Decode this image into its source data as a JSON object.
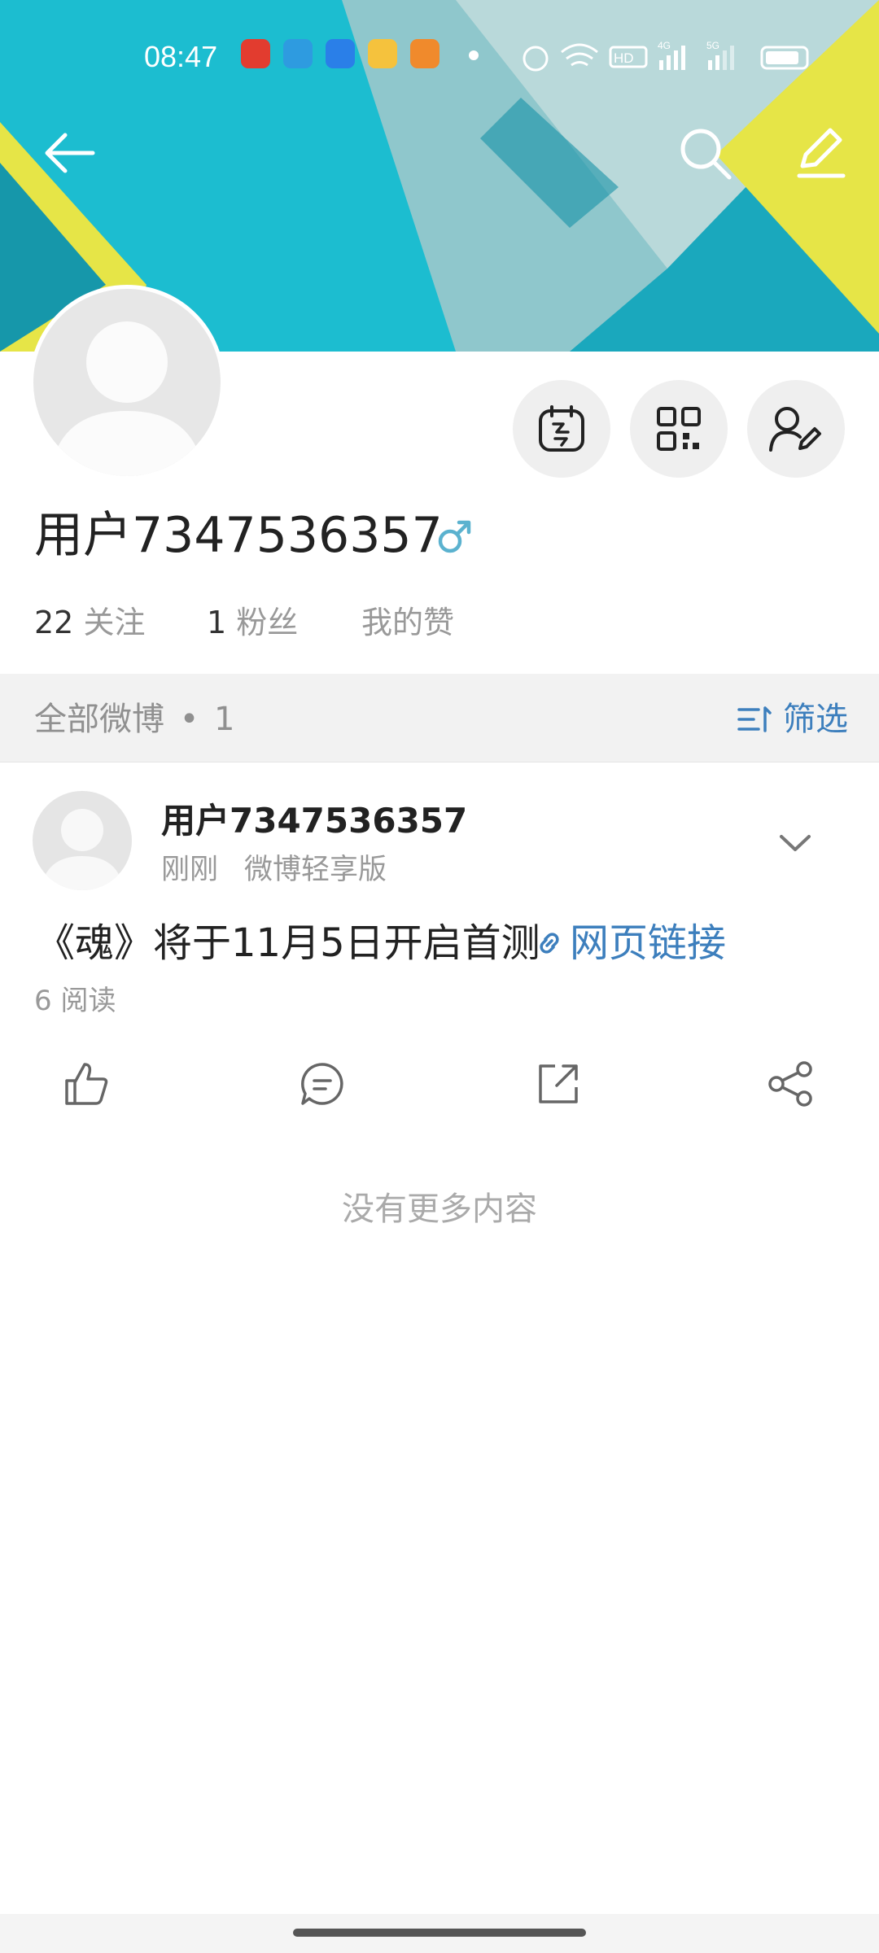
{
  "status_bar": {
    "time": "08:47",
    "icons": [
      "taobao-app-icon",
      "telegram-app-icon",
      "browser-app-icon",
      "wallet-app-icon",
      "shopping-app-icon",
      "dot-icon",
      "alarm-icon",
      "wifi-icon",
      "hd-icon",
      "signal-4g-icon",
      "signal-5g-icon",
      "battery-icon"
    ]
  },
  "header": {
    "back_icon": "arrow-left-icon",
    "search_icon": "search-icon",
    "edit_icon": "pencil-icon"
  },
  "profile": {
    "name": "用户7347536357",
    "gender_icon": "male-icon",
    "following_count": "22",
    "following_label": "关注",
    "fans_count": "1",
    "fans_label": "粉丝",
    "likes_label": "我的赞",
    "buttons": [
      "calendar-icon",
      "qr-code-icon",
      "edit-profile-icon"
    ]
  },
  "filter": {
    "all_label": "全部微博",
    "dot": "•",
    "count": "1",
    "filter_label": "筛选"
  },
  "post": {
    "author": "用户7347536357",
    "time": "刚刚",
    "source": "微博轻享版",
    "text": "《魂》将于11月5日开启首测",
    "link_label": "网页链接",
    "reads": "6 阅读"
  },
  "footer": {
    "no_more": "没有更多内容"
  },
  "colors": {
    "accent": "#3d7fbd",
    "banner_teal": "#1bb3c6",
    "banner_yellow": "#e6e547"
  }
}
